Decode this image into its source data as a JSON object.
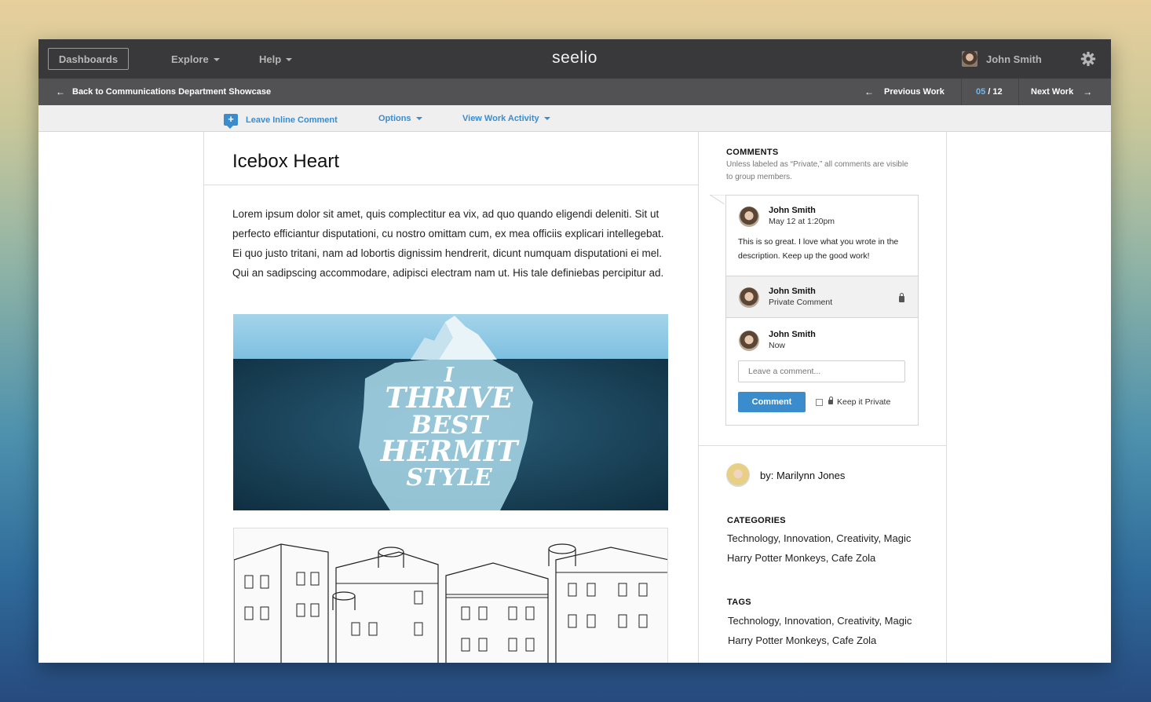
{
  "topbar": {
    "dashboards_label": "Dashboards",
    "explore_label": "Explore",
    "help_label": "Help",
    "logo": "seelio",
    "user_name": "John Smith"
  },
  "subbar": {
    "back_label": "Back to Communications Department Showcase",
    "previous_label": "Previous Work",
    "counter_current": "05",
    "counter_total": "/ 12",
    "next_label": "Next Work"
  },
  "actions": {
    "inline_comment_label": "Leave Inline Comment",
    "options_label": "Options",
    "activity_label": "View Work Activity"
  },
  "work": {
    "title": "Icebox Heart",
    "description": "Lorem ipsum dolor sit amet, quis complectitur ea vix, ad quo quando eligendi deleniti. Sit ut perfecto efficiantur disputationi, cu nostro omittam cum, ex mea officiis explicari intellegebat. Ei quo justo tritani, nam ad lobortis dignissim hendrerit, dicunt numquam disputationi ei mel. Qui an sadipscing accommodare, adipisci electram nam ut. His tale definiebas percipitur ad.",
    "artwork_lines": [
      "I",
      "THRIVE",
      "BEST",
      "HERMIT",
      "STYLE"
    ]
  },
  "comments": {
    "heading": "COMMENTS",
    "note": "Unless labeled as “Private,” all comments are visible to group members.",
    "items": [
      {
        "name": "John Smith",
        "sub": "May 12 at 1:20pm",
        "body": "This is so great. I love what you wrote in the description. Keep up the good work!"
      },
      {
        "name": "John Smith",
        "sub": "Private Comment"
      },
      {
        "name": "John Smith",
        "sub": "Now"
      }
    ],
    "input_placeholder": "Leave a comment...",
    "submit_label": "Comment",
    "private_label": "Keep it Private"
  },
  "author": {
    "label": "by: Marilynn Jones"
  },
  "categories": {
    "heading": "CATEGORIES",
    "line1": "Technology, Innovation, Creativity, Magic",
    "line2": "Harry Potter Monkeys, Cafe Zola"
  },
  "tags": {
    "heading": "TAGS",
    "line1": "Technology, Innovation, Creativity, Magic",
    "line2": "Harry Potter Monkeys, Cafe Zola"
  },
  "colors": {
    "accent": "#3a8ccc",
    "topbar": "#39393b",
    "subbar": "#525254",
    "counter_highlight": "#6fb6ea"
  }
}
